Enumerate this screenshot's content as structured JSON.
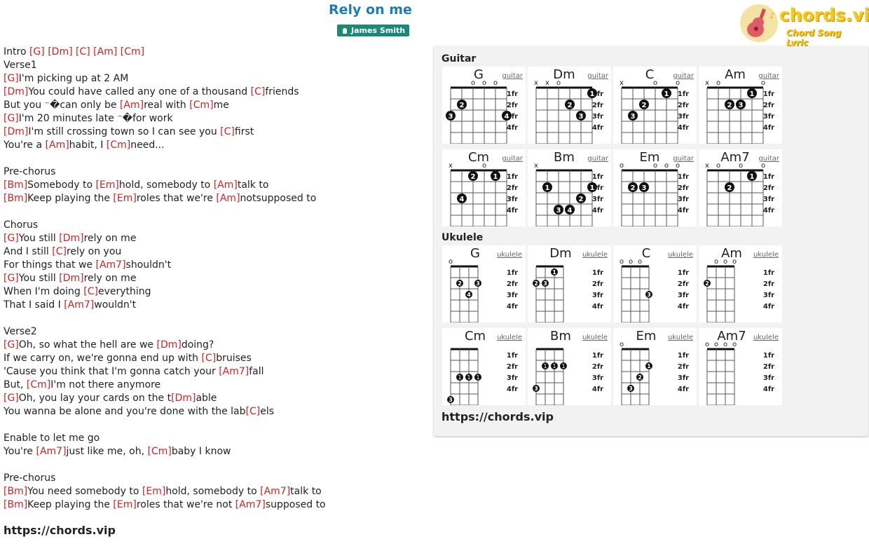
{
  "title": "Rely on me",
  "artist": "James Smith",
  "logo": {
    "text": "chords.vip",
    "subtitle": "Chord Song Lyric"
  },
  "lyrics": [
    [
      [
        "t",
        "Intro "
      ],
      [
        "c",
        "[G]"
      ],
      [
        "t",
        " "
      ],
      [
        "c",
        "[Dm]"
      ],
      [
        "t",
        " "
      ],
      [
        "c",
        "[C]"
      ],
      [
        "t",
        " "
      ],
      [
        "c",
        "[Am]"
      ],
      [
        "t",
        " "
      ],
      [
        "c",
        "[Cm]"
      ]
    ],
    [
      [
        "t",
        "Verse1"
      ]
    ],
    [
      [
        "c",
        "[G]"
      ],
      [
        "t",
        "I'm picking up at 2 AM"
      ]
    ],
    [
      [
        "c",
        "[Dm]"
      ],
      [
        "t",
        "You could have called any one of a thousand "
      ],
      [
        "c",
        "[C]"
      ],
      [
        "t",
        "friends"
      ]
    ],
    [
      [
        "t",
        "But you ⁻�can only be "
      ],
      [
        "c",
        "[Am]"
      ],
      [
        "t",
        "real with "
      ],
      [
        "c",
        "[Cm]"
      ],
      [
        "t",
        "me"
      ]
    ],
    [
      [
        "c",
        "[G]"
      ],
      [
        "t",
        "I'm 20 minutes late ⁻�for work"
      ]
    ],
    [
      [
        "c",
        "[Dm]"
      ],
      [
        "t",
        "I'm still crossing town so I can see you "
      ],
      [
        "c",
        "[C]"
      ],
      [
        "t",
        "first"
      ]
    ],
    [
      [
        "t",
        "You're a "
      ],
      [
        "c",
        "[Am]"
      ],
      [
        "t",
        "habit, I "
      ],
      [
        "c",
        "[Cm]"
      ],
      [
        "t",
        "need..."
      ]
    ],
    [],
    [
      [
        "t",
        "Pre-chorus"
      ]
    ],
    [
      [
        "c",
        "[Bm]"
      ],
      [
        "t",
        "Somebody to "
      ],
      [
        "c",
        "[Em]"
      ],
      [
        "t",
        "hold, somebody to "
      ],
      [
        "c",
        "[Am]"
      ],
      [
        "t",
        "talk to"
      ]
    ],
    [
      [
        "c",
        "[Bm]"
      ],
      [
        "t",
        "Keep playing the "
      ],
      [
        "c",
        "[Em]"
      ],
      [
        "t",
        "roles that we're "
      ],
      [
        "c",
        "[Am]"
      ],
      [
        "t",
        "notsupposed to"
      ]
    ],
    [],
    [
      [
        "t",
        "Chorus"
      ]
    ],
    [
      [
        "c",
        "[G]"
      ],
      [
        "t",
        "You still "
      ],
      [
        "c",
        "[Dm]"
      ],
      [
        "t",
        "rely on me"
      ]
    ],
    [
      [
        "t",
        "And I still "
      ],
      [
        "c",
        "[C]"
      ],
      [
        "t",
        "rely on you"
      ]
    ],
    [
      [
        "t",
        "For things that we "
      ],
      [
        "c",
        "[Am7]"
      ],
      [
        "t",
        "shouldn't"
      ]
    ],
    [
      [
        "c",
        "[G]"
      ],
      [
        "t",
        "You still "
      ],
      [
        "c",
        "[Dm]"
      ],
      [
        "t",
        "rely on me"
      ]
    ],
    [
      [
        "t",
        "When I'm doing "
      ],
      [
        "c",
        "[C]"
      ],
      [
        "t",
        "everything"
      ]
    ],
    [
      [
        "t",
        "That I said I "
      ],
      [
        "c",
        "[Am7]"
      ],
      [
        "t",
        "wouldn't"
      ]
    ],
    [],
    [
      [
        "t",
        "Verse2"
      ]
    ],
    [
      [
        "c",
        "[G]"
      ],
      [
        "t",
        "Oh, so what the hell are we "
      ],
      [
        "c",
        "[Dm]"
      ],
      [
        "t",
        "doing?"
      ]
    ],
    [
      [
        "t",
        "If we carry on, we're gonna end up with "
      ],
      [
        "c",
        "[C]"
      ],
      [
        "t",
        "bruises"
      ]
    ],
    [
      [
        "t",
        "'Cause you think that I'm gonna catch your "
      ],
      [
        "c",
        "[Am7]"
      ],
      [
        "t",
        "fall"
      ]
    ],
    [
      [
        "t",
        "But, "
      ],
      [
        "c",
        "[Cm]"
      ],
      [
        "t",
        "I'm not there anymore"
      ]
    ],
    [
      [
        "c",
        "[G]"
      ],
      [
        "t",
        "Oh, you lay your cards on the t"
      ],
      [
        "c",
        "[Dm]"
      ],
      [
        "t",
        "able"
      ]
    ],
    [
      [
        "t",
        "You wanna be alone and you're done with the lab"
      ],
      [
        "c",
        "[C]"
      ],
      [
        "t",
        "els"
      ]
    ],
    [],
    [
      [
        "t",
        "Enable to let me go"
      ]
    ],
    [
      [
        "t",
        "You're "
      ],
      [
        "c",
        "[Am7]"
      ],
      [
        "t",
        "just like me, oh, "
      ],
      [
        "c",
        "[Cm]"
      ],
      [
        "t",
        "baby I know"
      ]
    ],
    [],
    [
      [
        "t",
        "Pre-chorus"
      ]
    ],
    [
      [
        "c",
        "[Bm]"
      ],
      [
        "t",
        "You need somebody to "
      ],
      [
        "c",
        "[Em]"
      ],
      [
        "t",
        "hold, somebody to "
      ],
      [
        "c",
        "[Am7]"
      ],
      [
        "t",
        "talk to"
      ]
    ],
    [
      [
        "c",
        "[Bm]"
      ],
      [
        "t",
        "Keep playing the "
      ],
      [
        "c",
        "[Em]"
      ],
      [
        "t",
        "roles that we're not "
      ],
      [
        "c",
        "[Am7]"
      ],
      [
        "t",
        "supposed to"
      ]
    ]
  ],
  "site_url": "https://chords.vip",
  "panel": {
    "guitar_heading": "Guitar",
    "ukulele_heading": "Ukulele",
    "fret_labels": [
      "1fr",
      "2fr",
      "3fr",
      "4fr"
    ],
    "url": "https://chords.vip",
    "guitar": [
      {
        "name": "G",
        "link": "guitar",
        "top": [
          "",
          "",
          "o",
          "o",
          "o",
          ""
        ],
        "dots": [
          {
            "s": 1,
            "f": 2,
            "n": "2"
          },
          {
            "s": 0,
            "f": 3,
            "n": "3"
          },
          {
            "s": 5,
            "f": 3,
            "n": "4"
          }
        ],
        "barres": []
      },
      {
        "name": "Dm",
        "link": "guitar",
        "top": [
          "x",
          "x",
          "o",
          "",
          "",
          ""
        ],
        "dots": [
          {
            "s": 5,
            "f": 1,
            "n": "1"
          },
          {
            "s": 3,
            "f": 2,
            "n": "2"
          },
          {
            "s": 4,
            "f": 3,
            "n": "3"
          }
        ],
        "barres": []
      },
      {
        "name": "C",
        "link": "guitar",
        "top": [
          "x",
          "",
          "",
          "o",
          "",
          "o"
        ],
        "dots": [
          {
            "s": 4,
            "f": 1,
            "n": "1"
          },
          {
            "s": 2,
            "f": 2,
            "n": "2"
          },
          {
            "s": 1,
            "f": 3,
            "n": "3"
          }
        ],
        "barres": []
      },
      {
        "name": "Am",
        "link": "guitar",
        "top": [
          "x",
          "o",
          "",
          "",
          "",
          "o"
        ],
        "dots": [
          {
            "s": 4,
            "f": 1,
            "n": "1"
          },
          {
            "s": 2,
            "f": 2,
            "n": "2"
          },
          {
            "s": 3,
            "f": 2,
            "n": "3"
          }
        ],
        "barres": []
      },
      {
        "name": "Cm",
        "link": "guitar",
        "top": [
          "x",
          "",
          "",
          "o",
          "",
          ""
        ],
        "dots": [
          {
            "s": 2,
            "f": 1,
            "n": "2"
          },
          {
            "s": 4,
            "f": 1,
            "n": "1"
          },
          {
            "s": 1,
            "f": 3,
            "n": "4"
          }
        ],
        "barres": []
      },
      {
        "name": "Bm",
        "link": "guitar",
        "top": [
          "x",
          "",
          "",
          "",
          "",
          ""
        ],
        "dots": [
          {
            "s": 1,
            "f": 2,
            "n": "1"
          },
          {
            "s": 5,
            "f": 2,
            "n": "1"
          },
          {
            "s": 4,
            "f": 3,
            "n": "2"
          },
          {
            "s": 2,
            "f": 4,
            "n": "3"
          },
          {
            "s": 3,
            "f": 4,
            "n": "4"
          }
        ],
        "barres": []
      },
      {
        "name": "Em",
        "link": "guitar",
        "top": [
          "o",
          "",
          "",
          "o",
          "o",
          "o"
        ],
        "dots": [
          {
            "s": 1,
            "f": 2,
            "n": "2"
          },
          {
            "s": 2,
            "f": 2,
            "n": "3"
          }
        ],
        "barres": []
      },
      {
        "name": "Am7",
        "link": "guitar",
        "top": [
          "x",
          "o",
          "",
          "o",
          "",
          "o"
        ],
        "dots": [
          {
            "s": 4,
            "f": 1,
            "n": "1"
          },
          {
            "s": 2,
            "f": 2,
            "n": "2"
          }
        ],
        "barres": []
      }
    ],
    "ukulele": [
      {
        "name": "G",
        "link": "ukulele",
        "top": [
          "o",
          "",
          "",
          ""
        ],
        "dots": [
          {
            "s": 1,
            "f": 2,
            "n": "2"
          },
          {
            "s": 3,
            "f": 2,
            "n": "3"
          },
          {
            "s": 2,
            "f": 3,
            "n": "4"
          }
        ],
        "barres": []
      },
      {
        "name": "Dm",
        "link": "ukulele",
        "top": [
          "",
          "",
          "",
          ""
        ],
        "dots": [
          {
            "s": 2,
            "f": 1,
            "n": "1"
          },
          {
            "s": 0,
            "f": 2,
            "n": "2"
          },
          {
            "s": 1,
            "f": 2,
            "n": "3"
          }
        ],
        "barres": []
      },
      {
        "name": "C",
        "link": "ukulele",
        "top": [
          "o",
          "o",
          "o",
          ""
        ],
        "dots": [
          {
            "s": 3,
            "f": 3,
            "n": "3"
          }
        ],
        "barres": []
      },
      {
        "name": "Am",
        "link": "ukulele",
        "top": [
          "",
          "o",
          "o",
          "o"
        ],
        "dots": [
          {
            "s": 0,
            "f": 2,
            "n": "2"
          }
        ],
        "barres": []
      },
      {
        "name": "Cm",
        "link": "ukulele",
        "top": [
          "",
          "",
          "",
          ""
        ],
        "dots": [
          {
            "s": 0,
            "f": 5,
            "n": "3"
          }
        ],
        "barres": [
          {
            "from": 1,
            "to": 3,
            "f": 3,
            "n": "1"
          }
        ]
      },
      {
        "name": "Bm",
        "link": "ukulele",
        "top": [
          "",
          "",
          "",
          ""
        ],
        "dots": [
          {
            "s": 0,
            "f": 4,
            "n": "3"
          }
        ],
        "barres": [
          {
            "from": 1,
            "to": 3,
            "f": 2,
            "n": "1"
          }
        ]
      },
      {
        "name": "Em",
        "link": "ukulele",
        "top": [
          "o",
          "",
          "",
          ""
        ],
        "dots": [
          {
            "s": 3,
            "f": 2,
            "n": "1"
          },
          {
            "s": 2,
            "f": 3,
            "n": "2"
          },
          {
            "s": 1,
            "f": 4,
            "n": "3"
          }
        ],
        "barres": []
      },
      {
        "name": "Am7",
        "link": "ukulele",
        "top": [
          "o",
          "o",
          "o",
          "o"
        ],
        "dots": [],
        "barres": []
      }
    ]
  }
}
